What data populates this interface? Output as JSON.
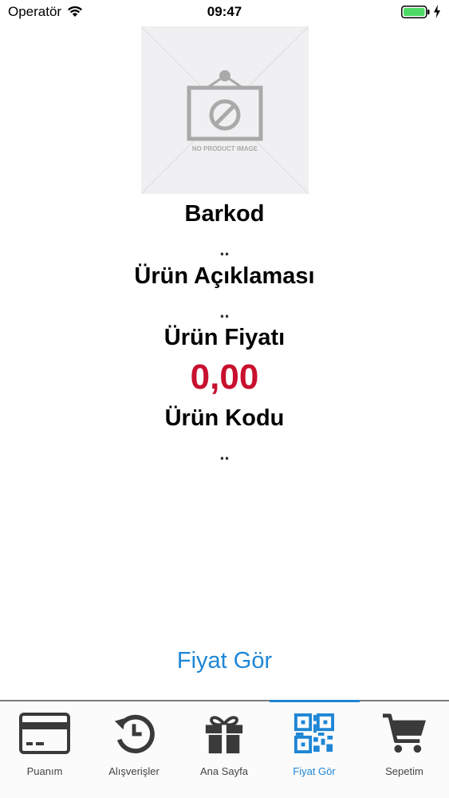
{
  "status_bar": {
    "carrier": "Operatör",
    "time": "09:47",
    "battery_color": "#4cd964"
  },
  "product": {
    "image_placeholder_text": "NO PRODUCT IMAGE",
    "barcode_label": "Barkod",
    "barcode_value": "..",
    "description_label": "Ürün Açıklaması",
    "description_value": "..",
    "price_label": "Ürün Fiyatı",
    "price_value": "0,00",
    "code_label": "Ürün Kodu",
    "code_value": ".."
  },
  "actions": {
    "show_price": "Fiyat Gör"
  },
  "tab_bar": {
    "accent_color": "#1e86d6",
    "active_tab": "Fiyat Gör",
    "tabs": [
      {
        "label": "Puanım",
        "icon": "credit-card-icon"
      },
      {
        "label": "Alışverişler",
        "icon": "history-icon"
      },
      {
        "label": "Ana Sayfa",
        "icon": "gift-icon"
      },
      {
        "label": "Fiyat Gör",
        "icon": "qr-code-icon"
      },
      {
        "label": "Sepetim",
        "icon": "cart-icon"
      }
    ]
  },
  "colors": {
    "price": "#c8102e",
    "link": "#1e86d6"
  }
}
